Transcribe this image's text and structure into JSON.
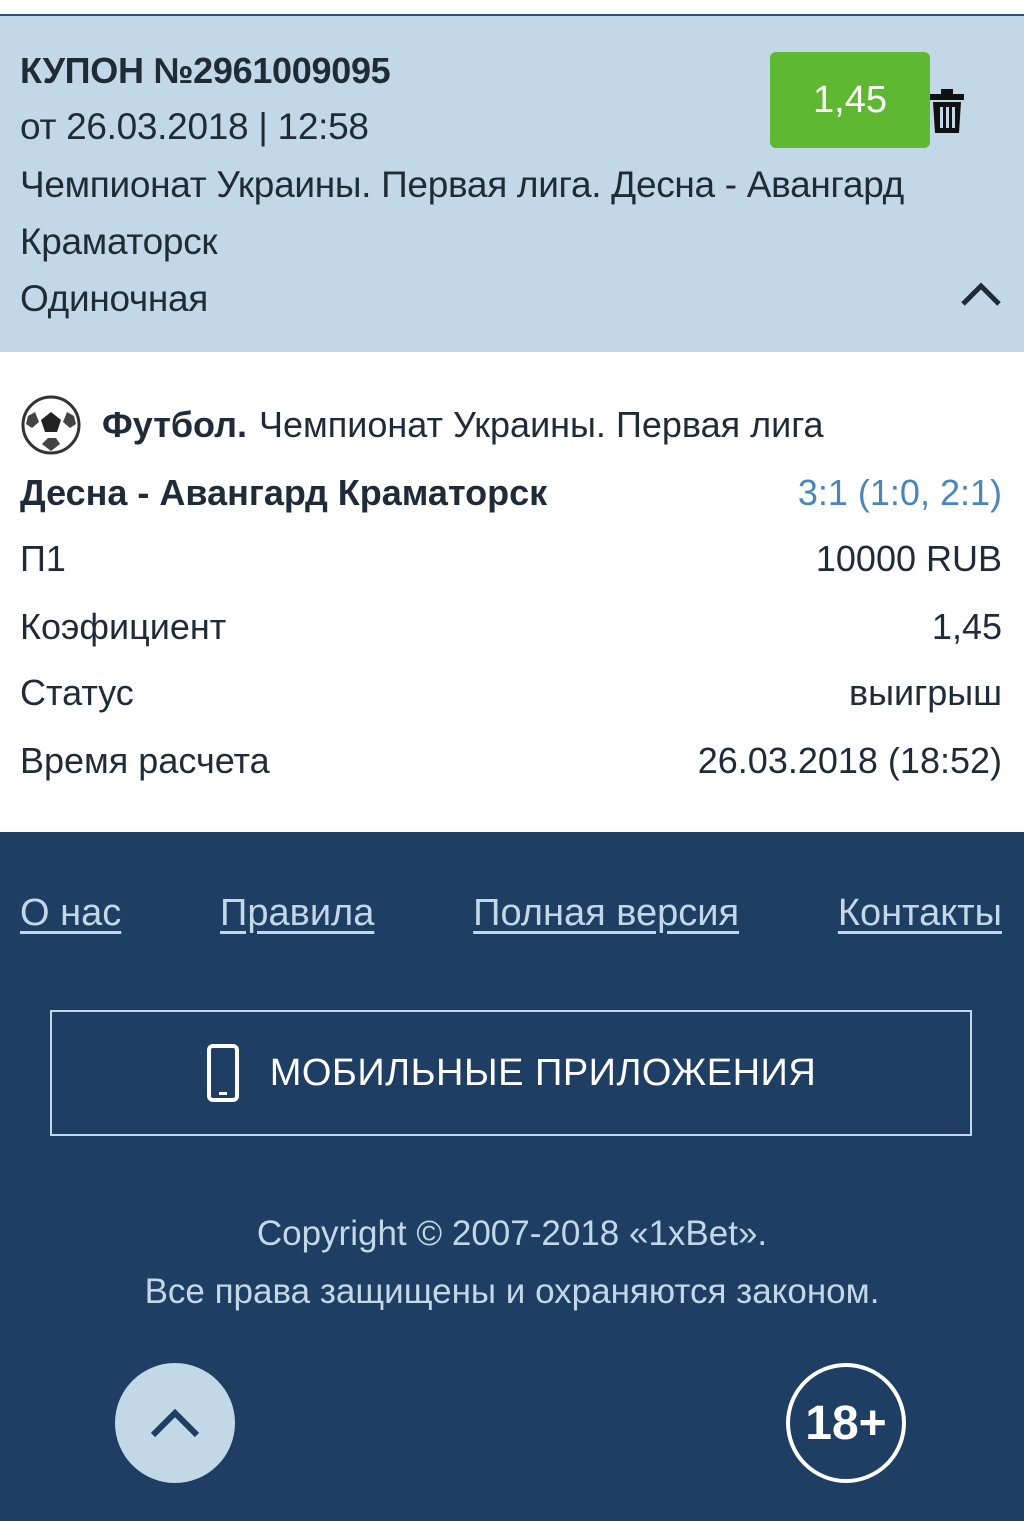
{
  "coupon": {
    "title": "КУПОН №2961009095",
    "date": "от 26.03.2018 | 12:58",
    "event_line1": "Чемпионат Украины. Первая лига. Десна - Авангард",
    "event_line2": "Краматорск",
    "type": "Одиночная",
    "coefficient": "1,45",
    "badge_color": "#5fb832"
  },
  "details": {
    "sport": "Футбол.",
    "league": "Чемпионат Украины. Первая лига",
    "match": "Десна - Авангард Краматорск",
    "score": "3:1 (1:0, 2:1)",
    "rows": [
      {
        "label": "П1",
        "value": "10000 RUB"
      },
      {
        "label": "Коэфициент",
        "value": "1,45"
      },
      {
        "label": "Статус",
        "value": "выигрыш"
      },
      {
        "label": "Время расчета",
        "value": "26.03.2018 (18:52)"
      }
    ]
  },
  "footer": {
    "links": [
      "О нас",
      "Правила",
      "Полная версия",
      "Контакты"
    ],
    "mobile_apps_label": "МОБИЛЬНЫЕ ПРИЛОЖЕНИЯ",
    "copyright_line1": "Copyright © 2007-2018 «1xBet».",
    "copyright_line2": "Все права защищены и охраняются законом.",
    "age_label": "18+"
  },
  "icons": [
    "trash-icon",
    "chevron-up-icon",
    "football-icon",
    "phone-icon"
  ]
}
